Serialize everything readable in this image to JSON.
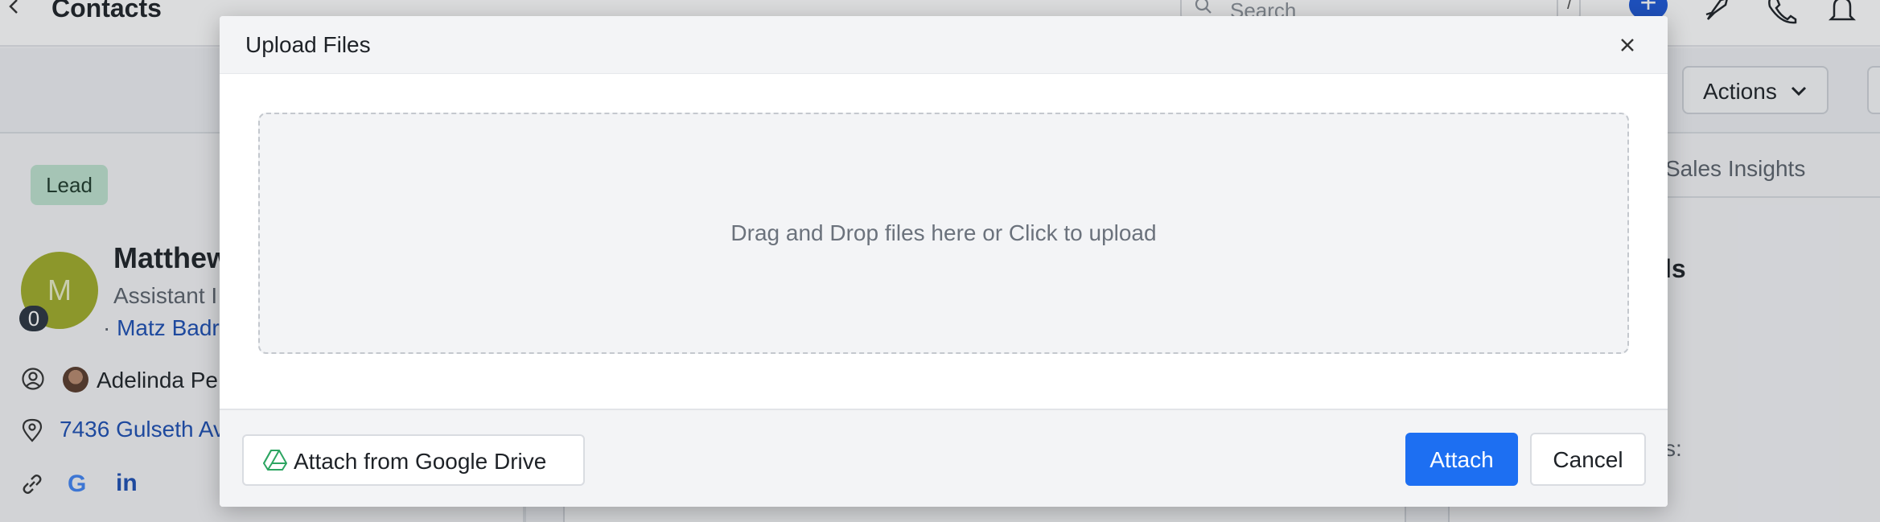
{
  "background": {
    "header": {
      "title": "Contacts",
      "search_placeholder": "Search",
      "search_shortcut": "/"
    },
    "toolbar": {
      "actions_label": "Actions"
    },
    "contact": {
      "status_badge": "Lead",
      "avatar_initial": "M",
      "avatar_count": "0",
      "name": "Matthew",
      "role": "Assistant I",
      "company_prefix": "·",
      "company": "Matz Badr",
      "owner": "Adelinda Pe",
      "address": "7436 Gulseth Av"
    },
    "right_panel": {
      "tab": "Sales Insights",
      "heading": "ls",
      "field_label": "s:"
    }
  },
  "modal": {
    "title": "Upload Files",
    "dropzone_text": "Drag and Drop files here or Click to upload",
    "gdrive_label": "Attach from Google Drive",
    "attach_label": "Attach",
    "cancel_label": "Cancel"
  },
  "colors": {
    "primary": "#1d6ff2",
    "lead_badge": "#bfe3cf",
    "avatar": "#a1ad2a",
    "link": "#1c4fb4"
  },
  "icons": [
    "chevron-left-icon",
    "search-icon",
    "plus-icon",
    "rocket-icon",
    "phone-icon",
    "bell-icon",
    "chevron-down-icon",
    "user-circle-icon",
    "location-pin-icon",
    "link-icon",
    "google-icon",
    "linkedin-icon",
    "close-icon",
    "google-drive-icon"
  ]
}
